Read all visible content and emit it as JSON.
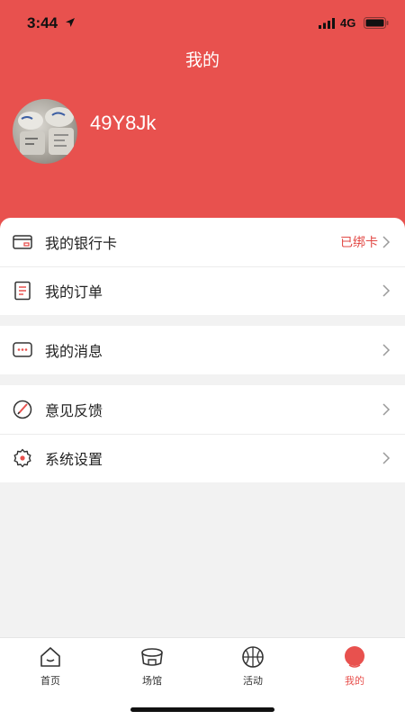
{
  "status": {
    "time": "3:44",
    "network": "4G"
  },
  "header": {
    "title": "我的",
    "username": "49Y8Jk"
  },
  "menu": {
    "bank_card": {
      "label": "我的银行卡",
      "value": "已绑卡",
      "icon": "bank-card-icon"
    },
    "orders": {
      "label": "我的订单",
      "icon": "order-list-icon"
    },
    "messages": {
      "label": "我的消息",
      "icon": "message-icon"
    },
    "feedback": {
      "label": "意见反馈",
      "icon": "feedback-icon"
    },
    "settings": {
      "label": "系统设置",
      "icon": "gear-icon"
    }
  },
  "tabs": [
    {
      "label": "首页",
      "icon": "home-icon"
    },
    {
      "label": "场馆",
      "icon": "stadium-icon"
    },
    {
      "label": "活动",
      "icon": "basketball-icon"
    },
    {
      "label": "我的",
      "icon": "profile-icon",
      "active": true
    }
  ],
  "colors": {
    "accent": "#e8514e",
    "value_text": "#e24a46"
  }
}
